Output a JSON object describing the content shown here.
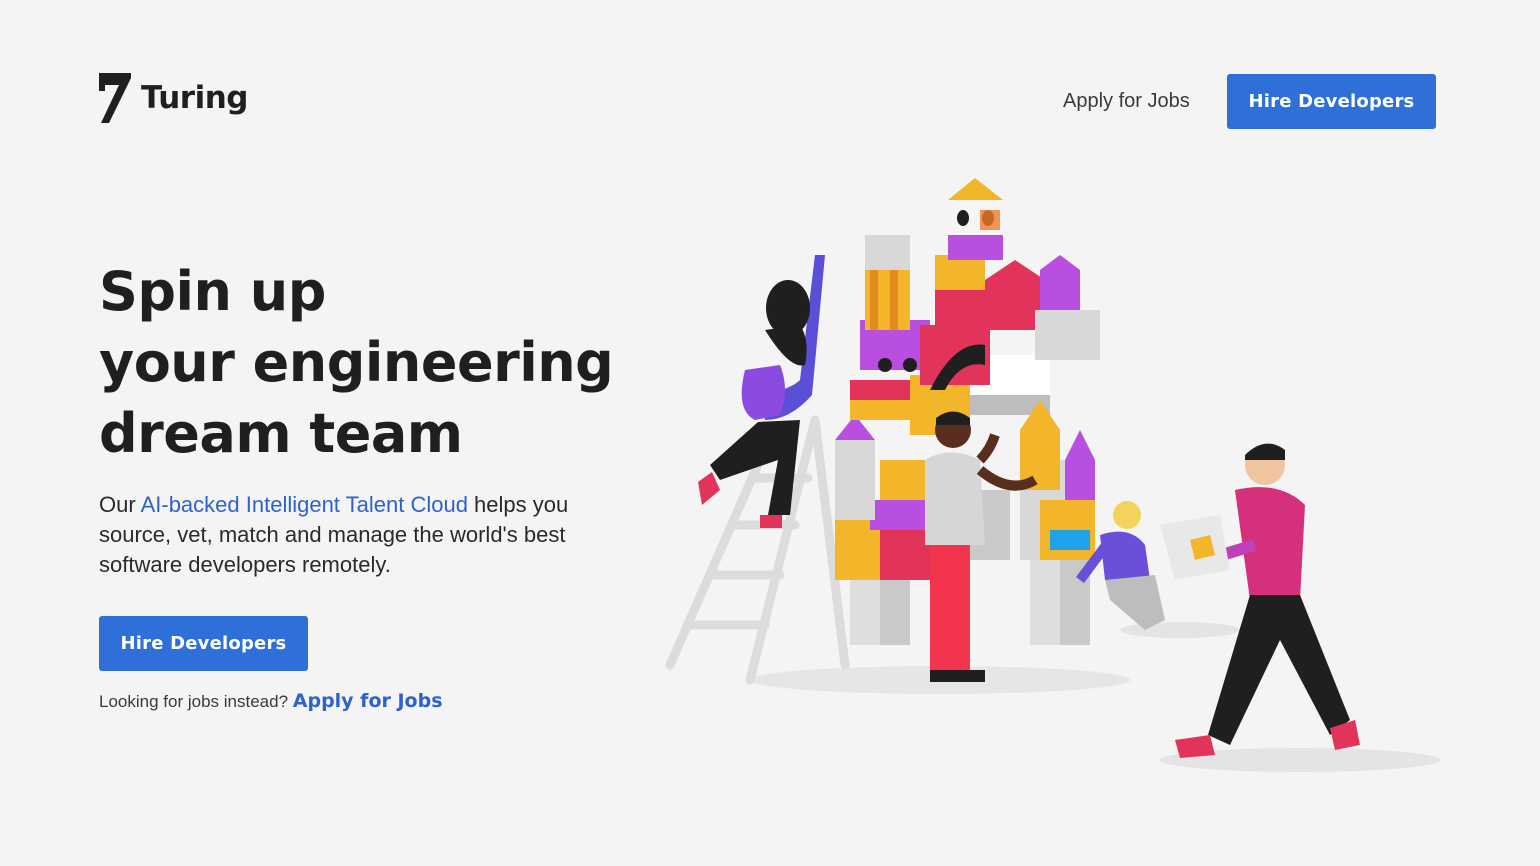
{
  "brand": {
    "name": "Turing",
    "logo_icon": "turing-logo-icon"
  },
  "nav": {
    "apply_label": "Apply for Jobs",
    "hire_label": "Hire Developers"
  },
  "hero": {
    "title_lines": [
      "Spin up",
      "your engineering",
      "dream team"
    ],
    "desc_before": "Our ",
    "desc_link": "AI-backed Intelligent Talent Cloud",
    "desc_after": " helps you source, vet, match and manage the world's best software developers remotely.",
    "cta_label": "Hire Developers",
    "jobs_prompt": "Looking for jobs instead?",
    "jobs_link": "Apply for Jobs"
  },
  "illustration": {
    "name": "team-building-blocks-illustration"
  },
  "colors": {
    "background": "#f4f4f4",
    "primary": "#2e6fd8",
    "link": "#2e63c9",
    "text": "#1f1f1f"
  }
}
